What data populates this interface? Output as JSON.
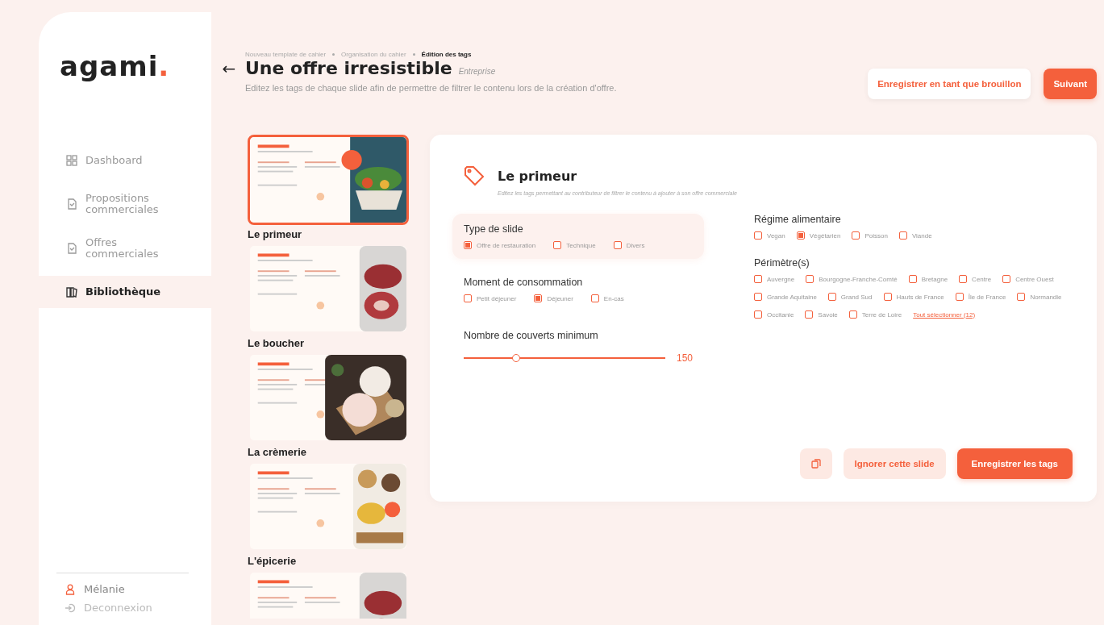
{
  "logo": {
    "text": "agami",
    "mark": "."
  },
  "sidebar": {
    "items": [
      {
        "label": "Dashboard",
        "selected": false
      },
      {
        "label": "Propositions commerciales",
        "selected": false
      },
      {
        "label": "Offres commerciales",
        "selected": false
      },
      {
        "label": "Bibliothèque",
        "selected": true
      }
    ],
    "user": "Mélanie",
    "logout": "Deconnexion"
  },
  "breadcrumb": [
    "Nouveau template de cahier",
    "Organisation du cahier",
    "Édition des tags"
  ],
  "header": {
    "back": "←",
    "title": "Une offre irresistible",
    "tag": "Entreprise",
    "subtitle": "Editez les tags de chaque slide afin de permettre de filtrer le contenu lors de la création d'offre.",
    "buttons": [
      {
        "label": "Enregistrer en tant que brouillon",
        "kind": "secondary"
      },
      {
        "label": "Suivant",
        "kind": "primary"
      }
    ]
  },
  "slides": [
    {
      "label": "Le primeur",
      "selected": true
    },
    {
      "label": "Le boucher",
      "selected": false
    },
    {
      "label": "La crèmerie",
      "selected": false
    },
    {
      "label": "L'épicerie",
      "selected": false
    },
    {
      "selected": false
    }
  ],
  "editor": {
    "title": "Le primeur",
    "subtitle": "Editez les tags permettant au contributeur de filtrer le contenu à ajouter à son offre commerciale",
    "left": [
      {
        "kind": "checks",
        "title": "Type de slide",
        "highlighted": true,
        "options": [
          {
            "label": "Offre de restauration",
            "checked": true
          },
          {
            "label": "Technique",
            "checked": false
          },
          {
            "label": "Divers",
            "checked": false
          }
        ]
      },
      {
        "kind": "checks",
        "title": "Moment de consommation",
        "highlighted": false,
        "options": [
          {
            "label": "Petit déjeuner",
            "checked": false
          },
          {
            "label": "Déjeuner",
            "checked": true
          },
          {
            "label": "En-cas",
            "checked": false
          }
        ]
      },
      {
        "kind": "slider",
        "title": "Nombre de couverts minimum",
        "highlighted": false,
        "level": 0.26,
        "reading": "150"
      }
    ],
    "right": [
      {
        "kind": "checks",
        "title": "Régime alimentaire",
        "highlighted": false,
        "options": [
          {
            "label": "Vegan",
            "checked": false
          },
          {
            "label": "Végétarien",
            "checked": true
          },
          {
            "label": "Poisson",
            "checked": false
          },
          {
            "label": "Viande",
            "checked": false
          }
        ]
      },
      {
        "kind": "checks",
        "title": "Périmètre(s)",
        "highlighted": false,
        "options": [
          {
            "label": "Auvergne",
            "checked": false
          },
          {
            "label": "Bourgogne-Franche-Comté",
            "checked": false
          },
          {
            "label": "Bretagne",
            "checked": false
          },
          {
            "label": "Centre",
            "checked": false
          },
          {
            "label": "Centre Ouest",
            "checked": false
          },
          {
            "label": "Grande Aquitaine",
            "checked": false
          },
          {
            "label": "Grand Sud",
            "checked": false
          },
          {
            "label": "Hauts de France",
            "checked": false
          },
          {
            "label": "Île de France",
            "checked": false
          },
          {
            "label": "Normandie",
            "checked": false
          },
          {
            "label": "Occitanie",
            "checked": false
          },
          {
            "label": "Savoie",
            "checked": false
          },
          {
            "label": "Terre de Loire",
            "checked": false
          }
        ],
        "select_all": "Tout sélectionner (12)"
      }
    ],
    "buttons": [
      {
        "label": "Ignorer cette slide",
        "kind": "secondary"
      },
      {
        "label": "Enregistrer les tags",
        "kind": "primary"
      }
    ]
  }
}
